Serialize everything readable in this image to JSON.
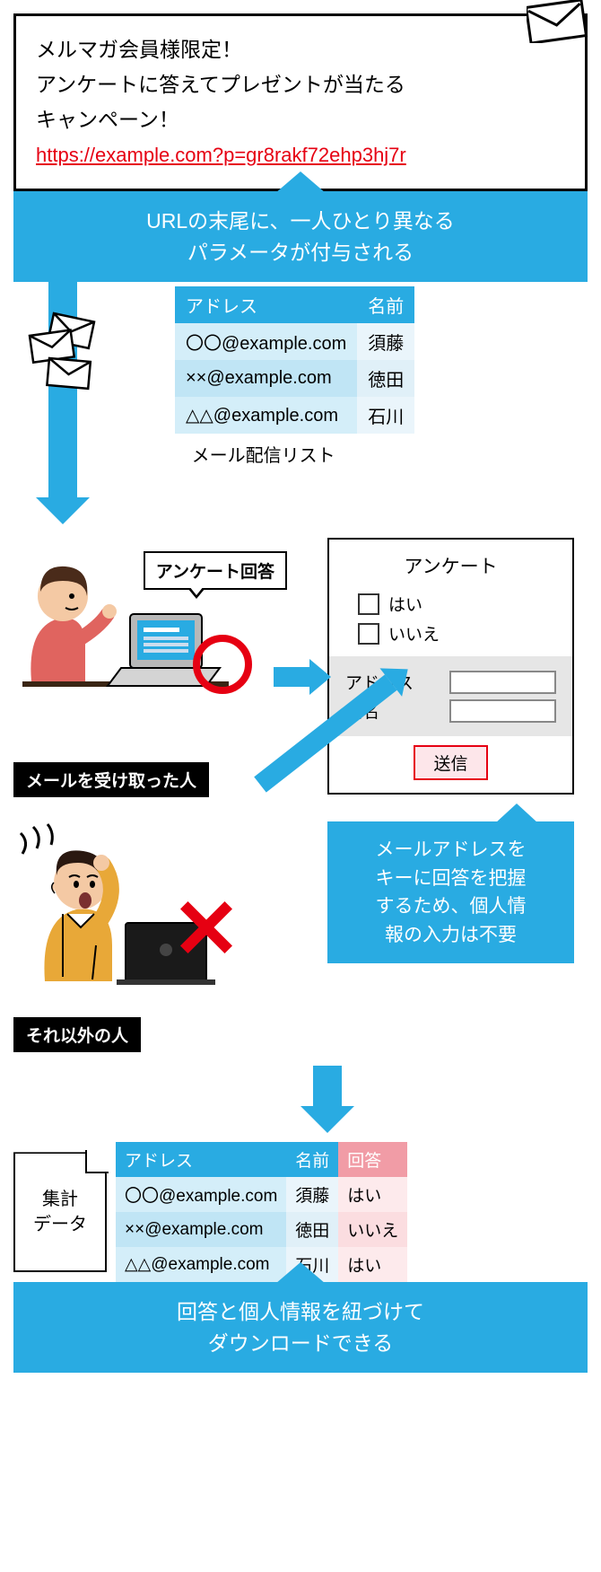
{
  "email": {
    "line1": "メルマガ会員様限定！",
    "line2": "アンケートに答えてプレゼントが当たる",
    "line3": "キャンペーン！",
    "url": "https://example.com?p=gr8rakf72ehp3hj7r"
  },
  "callout1": {
    "line1": "URLの末尾に、一人ひとり異なる",
    "line2": "パラメータが付与される"
  },
  "list_table": {
    "headers": [
      "アドレス",
      "名前"
    ],
    "rows": [
      [
        "〇〇@example.com",
        "須藤"
      ],
      [
        "××@example.com",
        "徳田"
      ],
      [
        "△△@example.com",
        "石川"
      ]
    ],
    "caption": "メール配信リスト"
  },
  "person1": {
    "bubble": "アンケート回答",
    "label": "メールを受け取った人"
  },
  "person2": {
    "label": "それ以外の人"
  },
  "survey": {
    "title": "アンケート",
    "opt1": "はい",
    "opt2": "いいえ",
    "field1": "アドレス",
    "field2": "氏名",
    "submit": "送信"
  },
  "callout2": {
    "line1": "メールアドレスを",
    "line2": "キーに回答を把握",
    "line3": "するため、個人情",
    "line4": "報の入力は不要"
  },
  "doc_label": {
    "line1": "集計",
    "line2": "データ"
  },
  "result_table": {
    "headers": [
      "アドレス",
      "名前",
      "回答"
    ],
    "rows": [
      [
        "〇〇@example.com",
        "須藤",
        "はい"
      ],
      [
        "××@example.com",
        "徳田",
        "いいえ"
      ],
      [
        "△△@example.com",
        "石川",
        "はい"
      ]
    ]
  },
  "callout3": {
    "line1": "回答と個人情報を紐づけて",
    "line2": "ダウンロードできる"
  }
}
